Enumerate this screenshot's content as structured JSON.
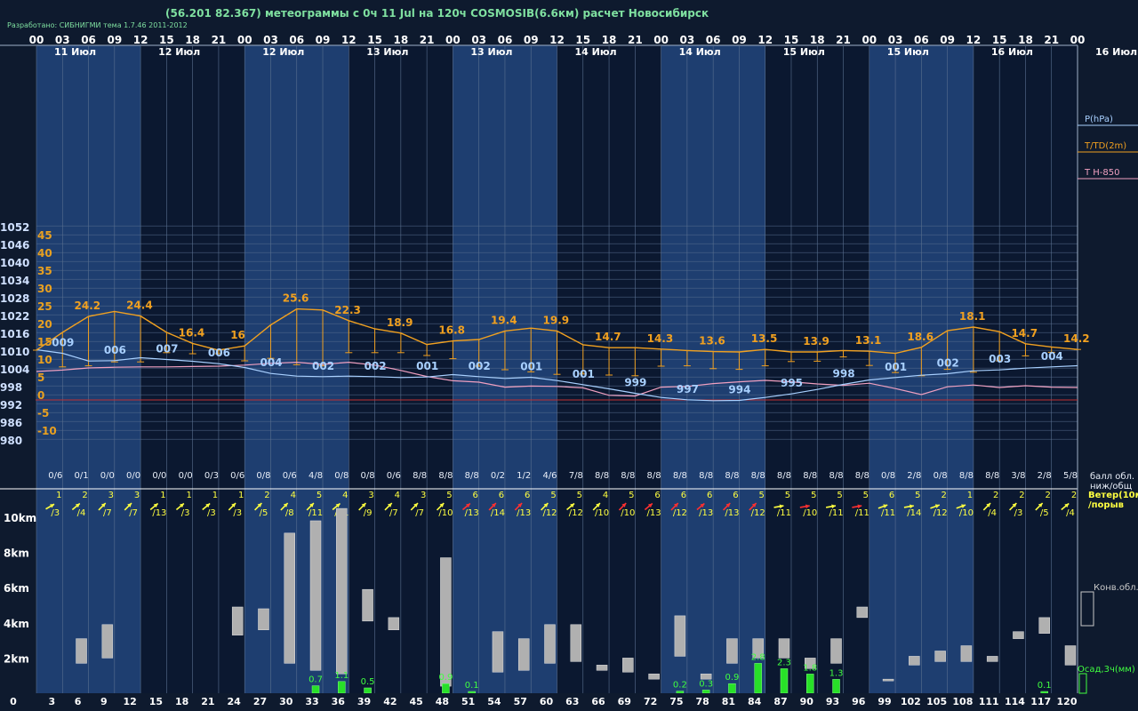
{
  "header": {
    "title": "(56.201 82.367) метеограммы с  0ч 11 Jul на 120ч COSMOSIB(6.6км) расчет Новосибирск",
    "credit": "Разработано: СИБНИГМИ тема 1.7.46 2011-2012"
  },
  "legend": {
    "pressure": "P(hPa)",
    "temperature": "T/TD(2m)",
    "t850": "T H-850",
    "cloud": "балл обл.\nниж/общ",
    "wind": "Ветер(10м)\n/порыв",
    "conv": "Конв.обл.",
    "precip": "Осад,3ч(мм)"
  },
  "colors": {
    "background": "#0e1a2e",
    "day_band": "#1e3e70",
    "night_band": "#0b1830",
    "temperature": "#f0a020",
    "pressure": "#a8d0ff",
    "t850": "#f0a0c0",
    "zero_line": "#c03030",
    "precip": "#28e028",
    "conv_cloud": "#b0b0b0",
    "wind_yellow": "#ffff40",
    "wind_red": "#ff3030"
  },
  "chart_data": {
    "type": "line",
    "hour_ticks": [
      "00",
      "03",
      "06",
      "09",
      "12",
      "15",
      "18",
      "21",
      "00",
      "03",
      "06",
      "09",
      "12",
      "15",
      "18",
      "21",
      "00",
      "03",
      "06",
      "09",
      "12",
      "15",
      "18",
      "21",
      "00",
      "03",
      "06",
      "09",
      "12",
      "15",
      "18",
      "21",
      "00",
      "03",
      "06",
      "09",
      "12",
      "15",
      "18",
      "21",
      "00"
    ],
    "date_labels": [
      "11 Июл",
      "12 Июл",
      "12 Июл",
      "13 Июл",
      "13 Июл",
      "14 Июл",
      "14 Июл",
      "15 Июл",
      "15 Июл",
      "16 Июл",
      "16 Июл"
    ],
    "pressure_axis": [
      "1052",
      "1046",
      "1040",
      "1034",
      "1028",
      "1022",
      "1016",
      "1010",
      "1004",
      "998",
      "992",
      "986",
      "980"
    ],
    "temp_axis": [
      "45",
      "40",
      "35",
      "30",
      "25",
      "20",
      "15",
      "10",
      "5",
      "0",
      "-5",
      "-10"
    ],
    "km_axis": [
      "10km",
      "8km",
      "6km",
      "4km",
      "2km"
    ],
    "lead_hours": [
      "0",
      "3",
      "6",
      "9",
      "12",
      "15",
      "18",
      "21",
      "24",
      "27",
      "30",
      "33",
      "36",
      "39",
      "42",
      "45",
      "48",
      "51",
      "54",
      "57",
      "60",
      "63",
      "66",
      "69",
      "72",
      "75",
      "78",
      "81",
      "84",
      "87",
      "90",
      "93",
      "96",
      "99",
      "102",
      "105",
      "108",
      "111",
      "114",
      "117",
      "120"
    ],
    "temperature": [
      14,
      19,
      23.5,
      24.9,
      23.6,
      19,
      15.9,
      14,
      15.2,
      21.1,
      25.6,
      25.3,
      22.3,
      20,
      18.8,
      15.6,
      16.6,
      17,
      19.4,
      20.2,
      19.4,
      15.5,
      14.7,
      14.7,
      14.3,
      13.9,
      13.6,
      13.5,
      14.2,
      13.5,
      13.5,
      13.9,
      13.7,
      13.1,
      14.8,
      19.5,
      20.5,
      19.2,
      15.8,
      14.9,
      14.2
    ],
    "dew_point": [
      14,
      9.3,
      9.6,
      10.7,
      10.7,
      13.3,
      13,
      13,
      11,
      11.7,
      9.9,
      9.6,
      13.3,
      13.3,
      13.3,
      12.5,
      11.6,
      9.5,
      8.5,
      7.9,
      7.2,
      7.3,
      7,
      6.8,
      9.5,
      9.6,
      8.8,
      8.6,
      9.6,
      10.8,
      10.9,
      12.1,
      9.7,
      7.7,
      6.8,
      8.6,
      7.8,
      11,
      12.4,
      13.4,
      14.2
    ],
    "pressure": [
      1010.2,
      1009,
      1006.4,
      1006.5,
      1007.5,
      1006.9,
      1006.3,
      1005.5,
      1004.2,
      1002.2,
      1001.3,
      1001.1,
      1001.3,
      1001.1,
      1000.8,
      1001,
      1001.8,
      1001.1,
      1000.5,
      1000.9,
      999.8,
      998.4,
      997,
      995.5,
      994.1,
      993.3,
      993,
      993.1,
      994.1,
      995.3,
      996.8,
      998.5,
      1000,
      1000.8,
      1001.6,
      1002.1,
      1003.1,
      1003.4,
      1004,
      1004.4,
      1004.8
    ],
    "pressure_labels": [
      "009",
      "006",
      "007",
      "006",
      "004",
      "002",
      "002",
      "001",
      "002",
      "001",
      "001",
      "999",
      "997",
      "994",
      "995",
      "998",
      "001",
      "002",
      "003",
      "004"
    ],
    "pressure_label_hours": [
      3,
      9,
      15,
      21,
      27,
      33,
      39,
      45,
      51,
      57,
      63,
      69,
      75,
      81,
      87,
      93,
      99,
      105,
      111,
      117
    ],
    "t850": [
      8,
      8.4,
      9,
      9.2,
      9.3,
      9.3,
      9.4,
      9.5,
      9.8,
      10.3,
      10.6,
      10,
      10.6,
      9.8,
      8.3,
      6.6,
      5.4,
      5,
      3.6,
      3.9,
      3.8,
      3.4,
      1.3,
      1.1,
      3.6,
      3.8,
      4.6,
      5.1,
      5.5,
      5.1,
      4.5,
      4.1,
      4.7,
      3.2,
      1.5,
      3.7,
      4.2,
      3.5,
      4,
      3.6,
      3.5
    ],
    "temp_labels": [
      "24.2",
      "24.4",
      "16.4",
      "16",
      "25.6",
      "22.3",
      "18.9",
      "16.8",
      "19.4",
      "19.9",
      "14.7",
      "14.3",
      "13.6",
      "13.5",
      "13.9",
      "13.1",
      "18.6",
      "18.1",
      "14.7",
      "14.2"
    ],
    "temp_label_hours": [
      6,
      12,
      18,
      24,
      30,
      36,
      42,
      48,
      54,
      60,
      66,
      72,
      78,
      84,
      90,
      96,
      102,
      108,
      114,
      120
    ],
    "cloud_cover": [
      "0/6",
      "0/1",
      "0/0",
      "0/0",
      "0/0",
      "0/0",
      "0/3",
      "0/6",
      "0/8",
      "0/6",
      "4/8",
      "0/8",
      "0/8",
      "0/6",
      "8/8",
      "8/8",
      "8/8",
      "0/2",
      "1/2",
      "4/6",
      "7/8",
      "8/8",
      "8/8",
      "8/8",
      "8/8",
      "8/8",
      "8/8",
      "8/8",
      "8/8",
      "8/8",
      "8/8",
      "8/8",
      "0/8",
      "2/8",
      "0/8",
      "8/8",
      "8/8",
      "3/8",
      "2/8",
      "5/8"
    ],
    "wind_speed": [
      "1",
      "2",
      "3",
      "3",
      "1",
      "1",
      "1",
      "1",
      "2",
      "4",
      "5",
      "4",
      "3",
      "4",
      "3",
      "5",
      "6",
      "6",
      "6",
      "5",
      "5",
      "4",
      "5",
      "6",
      "6",
      "6",
      "6",
      "5",
      "5",
      "5",
      "5",
      "5",
      "6",
      "5",
      "2",
      "1",
      "2",
      "2",
      "2",
      "2"
    ],
    "wind_gust": [
      "/3",
      "/4",
      "/7",
      "/7",
      "/13",
      "/3",
      "/3",
      "/3",
      "/5",
      "/8",
      "/11",
      "/11",
      "/9",
      "/7",
      "/7",
      "/10",
      "/13",
      "/14",
      "/13",
      "/12",
      "/12",
      "/10",
      "/10",
      "/13",
      "/12",
      "/13",
      "/13",
      "/12",
      "/11",
      "/10",
      "/11",
      "/11",
      "/11",
      "/14",
      "/12",
      "/10",
      "/4",
      "/3",
      "/5",
      "/4"
    ],
    "wind_color": [
      "y",
      "y",
      "y",
      "y",
      "y",
      "y",
      "y",
      "y",
      "y",
      "y",
      "y",
      "y",
      "y",
      "y",
      "y",
      "y",
      "r",
      "r",
      "r",
      "y",
      "y",
      "y",
      "r",
      "r",
      "r",
      "r",
      "r",
      "r",
      "y",
      "r",
      "y",
      "r",
      "y",
      "y",
      "y",
      "y",
      "y",
      "y",
      "y",
      "y"
    ],
    "wind_dir_deg": [
      240,
      230,
      225,
      225,
      230,
      230,
      230,
      225,
      225,
      225,
      225,
      230,
      225,
      225,
      225,
      225,
      230,
      225,
      225,
      225,
      230,
      225,
      225,
      230,
      225,
      230,
      225,
      225,
      260,
      260,
      260,
      260,
      250,
      260,
      250,
      250,
      225,
      225,
      225,
      230
    ],
    "conv_cloud_km": [
      [
        1.7,
        3.1
      ],
      [
        2,
        3.9
      ],
      [
        3.3,
        4.9
      ],
      [
        3.6,
        4.8
      ],
      [
        1.7,
        9.1
      ],
      [
        1.3,
        9.8
      ],
      [
        1.1,
        10.5
      ],
      [
        4.1,
        5.9
      ],
      [
        3.6,
        4.3
      ],
      [
        0.4,
        7.7
      ],
      [
        1.2,
        3.5
      ],
      [
        1.3,
        3.1
      ],
      [
        1.7,
        3.9
      ],
      [
        1.8,
        3.9
      ],
      [
        1.3,
        1.6
      ],
      [
        1.2,
        2.0
      ],
      [
        0.8,
        1.1
      ],
      [
        2.1,
        4.4
      ],
      [
        0.8,
        1.1
      ],
      [
        1.7,
        3.1
      ],
      [
        2,
        3.1
      ],
      [
        2,
        3.1
      ],
      [
        1.4,
        2
      ],
      [
        1.7,
        3.1
      ],
      [
        4.3,
        4.9
      ],
      [
        0.7,
        0.8
      ],
      [
        1.6,
        2.1
      ],
      [
        1.8,
        2.4
      ],
      [
        1.8,
        2.7
      ],
      [
        1.8,
        2.1
      ],
      [
        3.1,
        3.5
      ],
      [
        3.4,
        4.3
      ],
      [
        1.6,
        2.7
      ]
    ],
    "conv_cloud_hours": [
      6,
      9,
      24,
      27,
      30,
      33,
      36,
      39,
      42,
      48,
      54,
      57,
      60,
      63,
      66,
      69,
      72,
      75,
      78,
      81,
      84,
      87,
      90,
      93,
      96,
      99,
      102,
      105,
      108,
      111,
      114,
      117,
      120
    ],
    "precip_mm": [
      0.7,
      1.1,
      0.5,
      0.9,
      0.1,
      0.2,
      0.3,
      0.9,
      2.8,
      2.3,
      1.8,
      1.3,
      0.1
    ],
    "precip_labels": [
      "0.7",
      "1.1",
      "0.5",
      "0.9",
      "0.1",
      "0.2",
      "0.3",
      "0.9",
      "2.8",
      "2.3",
      "1.8",
      "1.3",
      "0.1"
    ],
    "precip_hours": [
      33,
      36,
      39,
      48,
      51,
      75,
      78,
      81,
      84,
      87,
      90,
      93,
      117
    ]
  }
}
